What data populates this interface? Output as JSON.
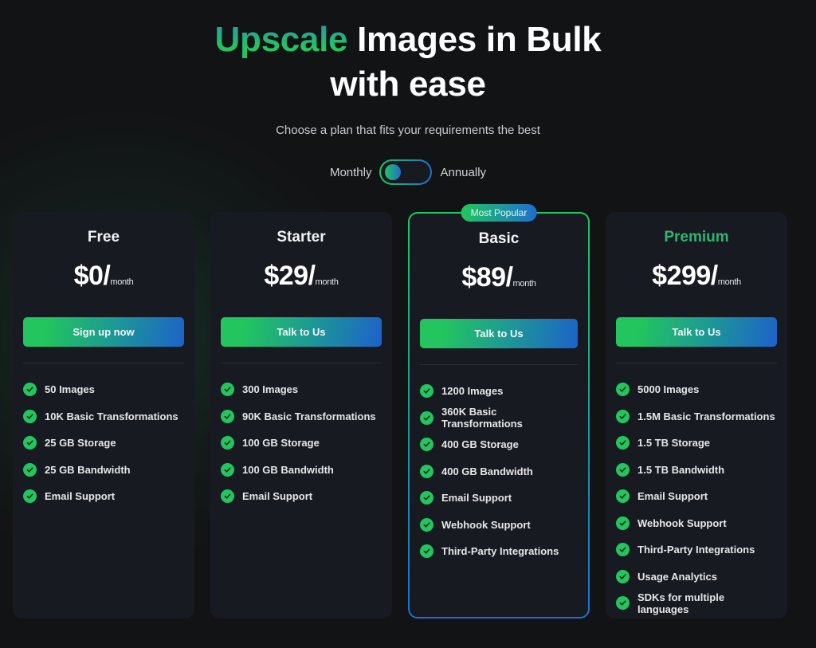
{
  "hero": {
    "title_accent": "Upscale",
    "title_line1_rest": " Images in Bulk",
    "title_line2": "with ease",
    "subtitle": "Choose a plan that fits your requirements the best"
  },
  "billing": {
    "monthly_label": "Monthly",
    "annually_label": "Annually",
    "selected": "Monthly"
  },
  "colors": {
    "accent_green": "#22c55e",
    "accent_blue": "#1d6fd0",
    "card_bg": "#181a21",
    "page_bg": "#121315",
    "premium_title": "#2bb673"
  },
  "plans": [
    {
      "name": "Free",
      "price": "$0/",
      "period": "month",
      "cta": "Sign up now",
      "features": [
        "50 Images",
        "10K Basic Transformations",
        "25 GB Storage",
        "25 GB Bandwidth",
        "Email Support"
      ]
    },
    {
      "name": "Starter",
      "price": "$29/",
      "period": "month",
      "cta": "Talk to Us",
      "features": [
        "300 Images",
        "90K Basic Transformations",
        "100 GB Storage",
        "100 GB Bandwidth",
        "Email Support"
      ]
    },
    {
      "name": "Basic",
      "badge": "Most Popular",
      "price": "$89/",
      "period": "month",
      "cta": "Talk to Us",
      "features": [
        "1200 Images",
        "360K Basic Transformations",
        "400 GB Storage",
        "400 GB Bandwidth",
        "Email Support",
        "Webhook Support",
        "Third-Party Integrations"
      ]
    },
    {
      "name": "Premium",
      "price": "$299/",
      "period": "month",
      "cta": "Talk to Us",
      "features": [
        "5000 Images",
        "1.5M Basic Transformations",
        "1.5 TB Storage",
        "1.5 TB Bandwidth",
        "Email Support",
        "Webhook Support",
        "Third-Party Integrations",
        "Usage Analytics",
        "SDKs for multiple languages"
      ]
    }
  ]
}
